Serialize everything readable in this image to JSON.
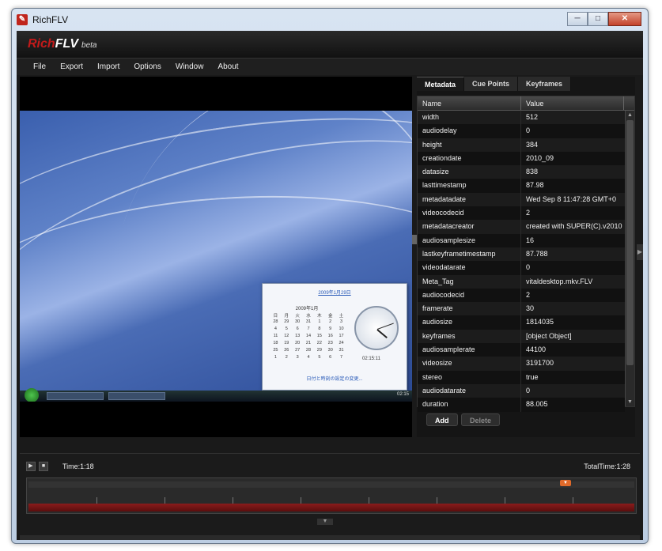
{
  "window": {
    "title": "RichFLV",
    "app_icon_glyph": "✎"
  },
  "brand": {
    "name_red": "Rich",
    "name_white": "FLV",
    "tag": "beta"
  },
  "menu": [
    {
      "label": "File"
    },
    {
      "label": "Export"
    },
    {
      "label": "Import"
    },
    {
      "label": "Options"
    },
    {
      "label": "Window"
    },
    {
      "label": "About"
    }
  ],
  "video": {
    "calendar": {
      "header": "2009年1月29日",
      "month": "2009年1月",
      "day_names": [
        "日",
        "月",
        "火",
        "水",
        "木",
        "金",
        "土"
      ],
      "days": [
        "28",
        "29",
        "30",
        "31",
        "1",
        "2",
        "3",
        "4",
        "5",
        "6",
        "7",
        "8",
        "9",
        "10",
        "11",
        "12",
        "13",
        "14",
        "15",
        "16",
        "17",
        "18",
        "19",
        "20",
        "21",
        "22",
        "23",
        "24",
        "25",
        "26",
        "27",
        "28",
        "29",
        "30",
        "31",
        "1",
        "2",
        "3",
        "4",
        "5",
        "6",
        "7"
      ],
      "clock_time": "02:15:11",
      "link": "日付と時刻の設定の変更..."
    },
    "taskbar": {
      "time": "02:15"
    }
  },
  "tabs": [
    {
      "label": "Metadata",
      "active": true
    },
    {
      "label": "Cue Points",
      "active": false
    },
    {
      "label": "Keyframes",
      "active": false
    }
  ],
  "metadata_table": {
    "columns": {
      "name": "Name",
      "value": "Value"
    },
    "rows": [
      {
        "name": "width",
        "value": "512"
      },
      {
        "name": "audiodelay",
        "value": "0"
      },
      {
        "name": "height",
        "value": "384"
      },
      {
        "name": "creationdate",
        "value": "2010_09"
      },
      {
        "name": "datasize",
        "value": "838"
      },
      {
        "name": "lasttimestamp",
        "value": "87.98"
      },
      {
        "name": "metadatadate",
        "value": "Wed Sep 8 11:47:28 GMT+0"
      },
      {
        "name": "videocodecid",
        "value": "2"
      },
      {
        "name": "metadatacreator",
        "value": "created with SUPER(C).v2010"
      },
      {
        "name": "audiosamplesize",
        "value": "16"
      },
      {
        "name": "lastkeyframetimestamp",
        "value": "87.788"
      },
      {
        "name": "videodatarate",
        "value": "0"
      },
      {
        "name": "Meta_Tag",
        "value": "vitaldesktop.mkv.FLV"
      },
      {
        "name": "audiocodecid",
        "value": "2"
      },
      {
        "name": "framerate",
        "value": "30"
      },
      {
        "name": "audiosize",
        "value": "1814035"
      },
      {
        "name": "keyframes",
        "value": "[object Object]"
      },
      {
        "name": "audiosamplerate",
        "value": "44100"
      },
      {
        "name": "videosize",
        "value": "3191700"
      },
      {
        "name": "stereo",
        "value": "true"
      },
      {
        "name": "audiodatarate",
        "value": "0"
      },
      {
        "name": "duration",
        "value": "88.005"
      }
    ]
  },
  "buttons": {
    "add": "Add",
    "delete": "Delete"
  },
  "player": {
    "time": "Time:1:18",
    "total_time": "TotalTime:1:28",
    "play_glyph": "▶",
    "stop_glyph": "■"
  }
}
